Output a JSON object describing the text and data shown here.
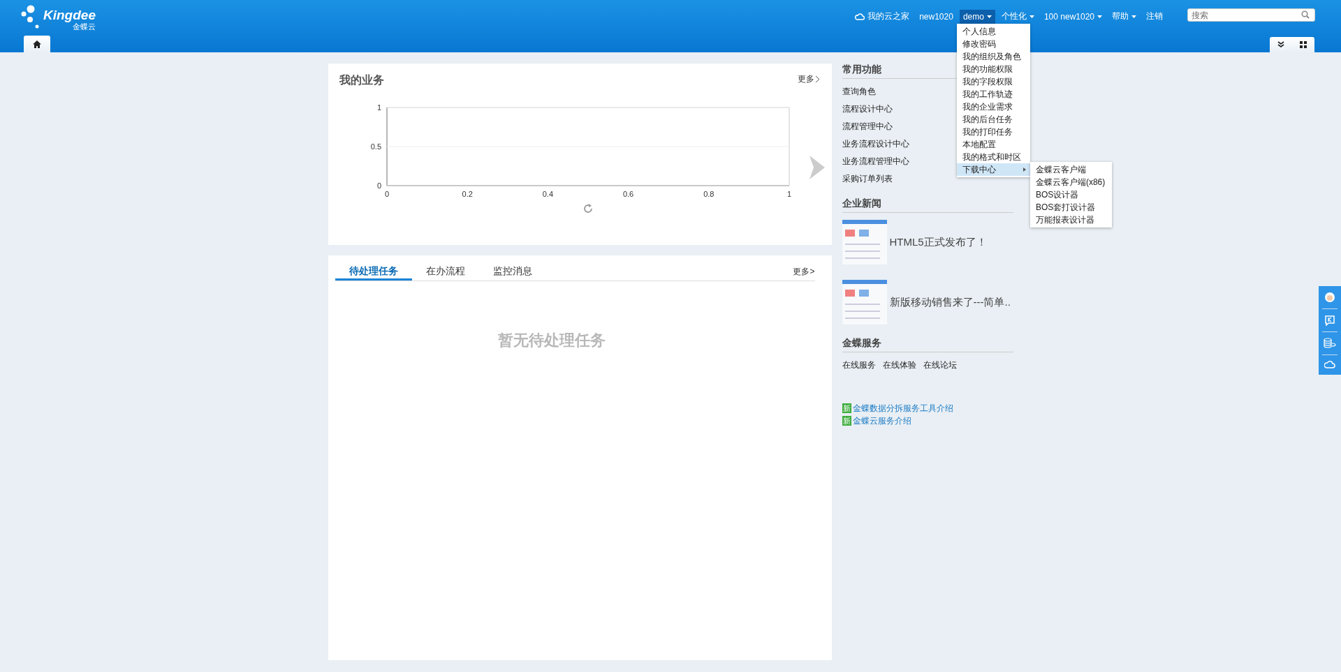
{
  "header": {
    "logo": {
      "name": "Kingdee",
      "subtitle": "金蝶云"
    },
    "nav": [
      {
        "label": "我的云之家",
        "kind": "cloud",
        "selected": false
      },
      {
        "label": "new1020",
        "kind": "text",
        "selected": false
      },
      {
        "label": "demo",
        "kind": "dropdown",
        "selected": true
      },
      {
        "label": "个性化",
        "kind": "dropdown",
        "selected": false
      },
      {
        "label": "100  new1020",
        "kind": "dropdown",
        "selected": false
      },
      {
        "label": "帮助",
        "kind": "dropdown",
        "selected": false
      },
      {
        "label": "注销",
        "kind": "text",
        "selected": false
      }
    ],
    "search": {
      "placeholder": "搜索"
    }
  },
  "user_menu": {
    "items": [
      {
        "label": "个人信息",
        "selected": false,
        "has_submenu": false
      },
      {
        "label": "修改密码",
        "selected": false,
        "has_submenu": false
      },
      {
        "label": "我的组织及角色",
        "selected": false,
        "has_submenu": false
      },
      {
        "label": "我的功能权限",
        "selected": false,
        "has_submenu": false
      },
      {
        "label": "我的字段权限",
        "selected": false,
        "has_submenu": false
      },
      {
        "label": "我的工作轨迹",
        "selected": false,
        "has_submenu": false
      },
      {
        "label": "我的企业需求",
        "selected": false,
        "has_submenu": false
      },
      {
        "label": "我的后台任务",
        "selected": false,
        "has_submenu": false
      },
      {
        "label": "我的打印任务",
        "selected": false,
        "has_submenu": false
      },
      {
        "label": "本地配置",
        "selected": false,
        "has_submenu": false
      },
      {
        "label": "我的格式和时区",
        "selected": false,
        "has_submenu": false
      },
      {
        "label": "下载中心",
        "selected": true,
        "has_submenu": true
      }
    ],
    "submenu": [
      "金蝶云客户端",
      "金蝶云客户端(x86)",
      "BOS设计器",
      "BOS套打设计器",
      "万能报表设计器"
    ]
  },
  "my_business": {
    "title": "我的业务",
    "more": "更多",
    "chart_data": {
      "type": "line",
      "xlim": [
        0,
        1
      ],
      "ylim": [
        0,
        1
      ],
      "xticks": [
        0,
        0.2,
        0.4,
        0.6,
        0.8,
        1
      ],
      "yticks": [
        0,
        0.5,
        1
      ]
    }
  },
  "tasks": {
    "tabs": [
      {
        "label": "待处理任务",
        "selected": true
      },
      {
        "label": "在办流程",
        "selected": false
      },
      {
        "label": "监控消息",
        "selected": false
      }
    ],
    "more": "更多>",
    "empty_message": "暂无待处理任务"
  },
  "sidebar": {
    "common": {
      "title": "常用功能",
      "items": [
        "查询角色",
        "流程设计中心",
        "流程管理中心",
        "业务流程设计中心",
        "业务流程管理中心",
        "采购订单列表"
      ]
    },
    "news": {
      "title": "企业新闻",
      "items": [
        {
          "title": "HTML5正式发布了！"
        },
        {
          "title": "新版移动销售来了---简单.."
        }
      ]
    },
    "services": {
      "title": "金蝶服务",
      "links": [
        "在线服务",
        "在线体验",
        "在线论坛"
      ]
    },
    "notices": [
      {
        "badge": "新",
        "text": "金蝶数据分拆服务工具介绍"
      },
      {
        "badge": "新",
        "text": "金蝶云服务介绍"
      }
    ]
  }
}
